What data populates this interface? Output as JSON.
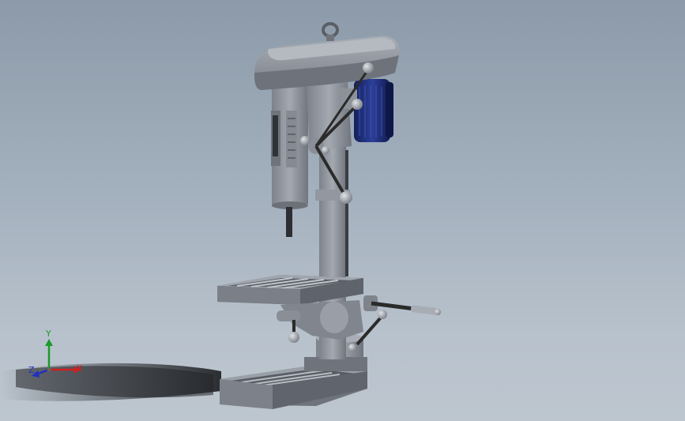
{
  "viewport": {
    "background_top": "#8c9aa9",
    "background_bottom": "#bdc6cf"
  },
  "model": {
    "body_color": "#8e939c",
    "motor_color": "#1f2f7a",
    "handle_color": "#2b2b2b",
    "knob_color": "#a8adb5"
  },
  "triad": {
    "x_label": "X",
    "y_label": "Y",
    "z_label": "Z",
    "x_color": "#d02020",
    "y_color": "#1a9a2a",
    "z_color": "#2030c0"
  }
}
